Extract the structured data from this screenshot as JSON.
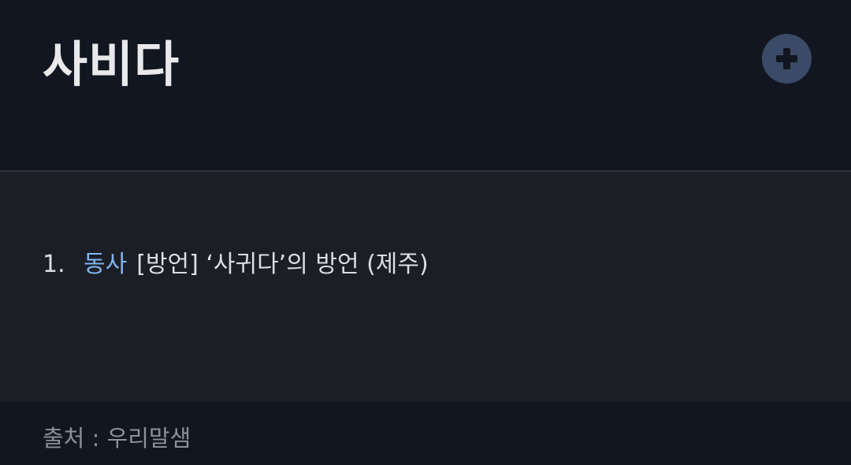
{
  "header": {
    "word": "사비다",
    "add_button_icon": "plus-circle-icon",
    "add_button_color": "#3b4a66"
  },
  "definitions": [
    {
      "number": "1.",
      "part_of_speech": "동사",
      "text": "[방언] ‘사귀다’의 방언 (제주)"
    }
  ],
  "source": {
    "text": "출처 : 우리말샘"
  },
  "colors": {
    "background": "#121620",
    "panel": "#1b1e24",
    "accent": "#7fb5f2"
  }
}
